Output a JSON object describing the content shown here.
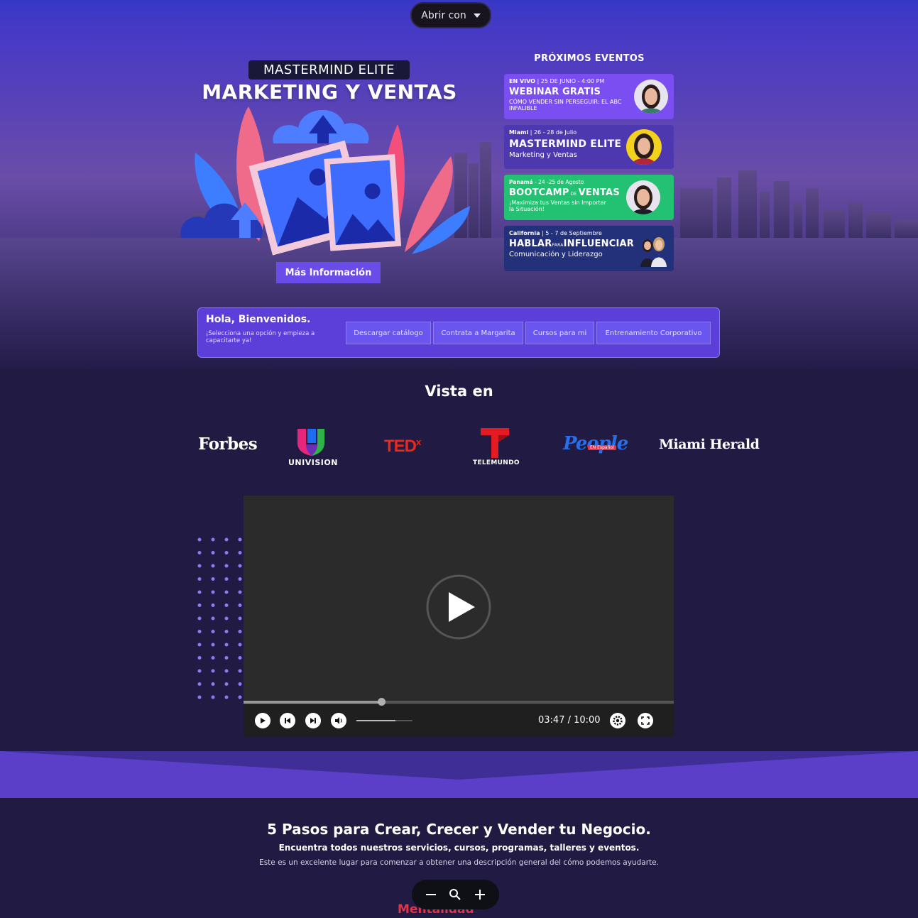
{
  "browser": {
    "open_with_label": "Abrir con"
  },
  "hero": {
    "badge": "MASTERMIND ELITE",
    "title": "MARKETING Y VENTAS",
    "more_info_label": "Más Información",
    "image_placeholder_icon": "image-placeholder-icon"
  },
  "events": {
    "heading": "PRÓXIMOS EVENTOS",
    "items": [
      {
        "meta_bold": "EN VIVO",
        "meta": " | 25 DE JUNIO - 4:00 PM",
        "title": "WEBINAR GRATIS",
        "subtitle": "CÓMO VENDER SIN PERSEGUIR: EL ABC INFALIBLE",
        "color": "#7a4ef0"
      },
      {
        "meta_bold": "Miami",
        "meta": " | 26 - 28 de Julio",
        "title": "MASTERMIND ELITE",
        "subtitle": "Marketing y Ventas",
        "color": "#4d38b0"
      },
      {
        "meta_bold": "Panamá",
        "meta": " - 24 -25 de Agosto",
        "title_a": "BOOTCAMP",
        "title_small": " DE ",
        "title_b": "VENTAS",
        "subtitle": "¡Maximiza tus Ventas sin Importar la Situación!",
        "color": "#23c172"
      },
      {
        "meta_bold": "California",
        "meta": "  | 5 - 7 de Septiembre",
        "title_a": "HABLAR",
        "title_small": "PARA",
        "title_b": "INFLUENCIAR",
        "subtitle": "Comunicación y Liderazgo",
        "color": "#23307a"
      }
    ]
  },
  "welcome": {
    "title": "Hola, Bienvenidos.",
    "subtitle": "¡Selecciona una opción y empieza a capacitarte ya!",
    "buttons": [
      "Descargar catálogo",
      "Contrata a Margarita",
      "Cursos para mi",
      "Entrenamiento Corporativo"
    ]
  },
  "featured": {
    "title": "Vista en",
    "logos": {
      "forbes": "Forbes",
      "univision": "UNIVISION",
      "tedx_main": "TED",
      "tedx_sup": "x",
      "telemundo": "TELEMUNDO",
      "people": "People",
      "people_tag": "EN Español",
      "miami_herald": "Miami Herald"
    }
  },
  "video": {
    "time": "03:47 / 10:00",
    "progress_fraction": 0.32,
    "volume_fraction": 0.7
  },
  "steps": {
    "title": "5 Pasos para Crear, Crecer y Vender tu Negocio.",
    "subtitle": "Encuentra todos nuestros servicios, cursos, programas, talleres y eventos.",
    "description": "Este es un excelente lugar para comenzar a obtener una descripción general del cómo podemos ayudarte.",
    "next_heading": "Mentalidad"
  },
  "zoom": {
    "minus_icon": "zoom-out-icon",
    "search_icon": "magnifier-icon",
    "plus_icon": "zoom-in-icon"
  }
}
